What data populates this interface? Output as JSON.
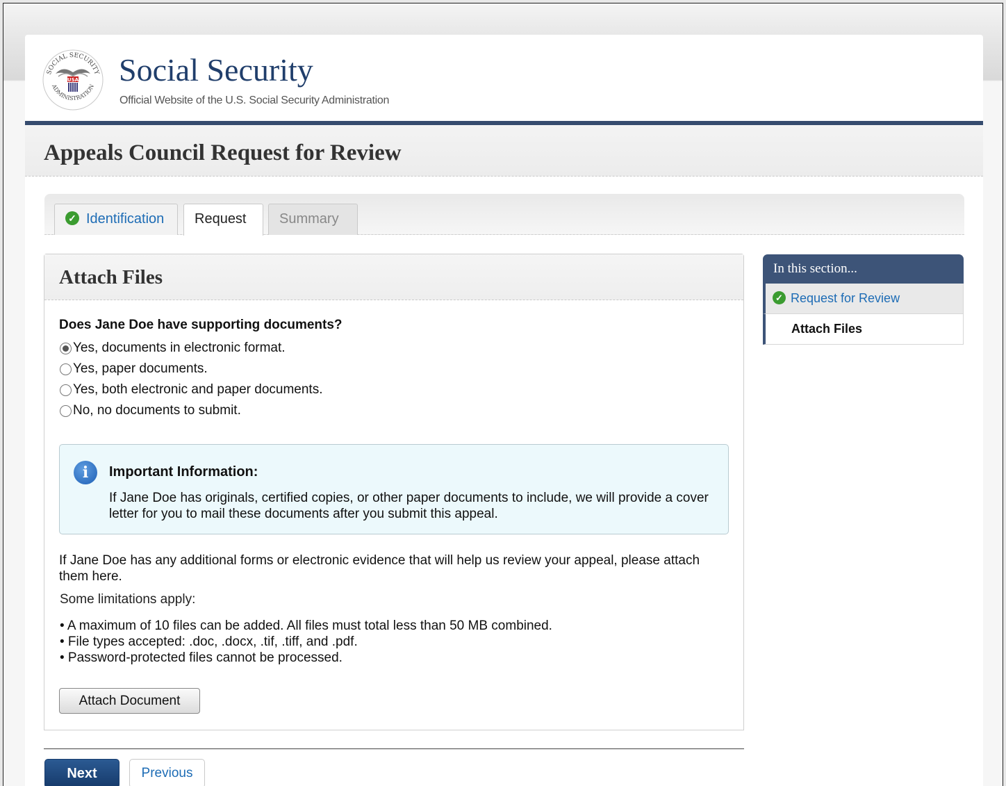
{
  "site": {
    "title": "Social Security",
    "subtitle": "Official Website of the U.S. Social Security Administration",
    "seal_top_text": "SOCIAL SECURITY",
    "seal_bottom_text": "ADMINISTRATION",
    "seal_center_text": "USA"
  },
  "page_title": "Appeals Council Request for Review",
  "tabs": [
    {
      "label": "Identification",
      "state": "completed"
    },
    {
      "label": "Request",
      "state": "active"
    },
    {
      "label": "Summary",
      "state": "disabled"
    }
  ],
  "panel": {
    "title": "Attach Files",
    "question": "Does Jane Doe have supporting documents?",
    "options": [
      {
        "label": "Yes, documents in electronic format.",
        "checked": true
      },
      {
        "label": "Yes, paper documents.",
        "checked": false
      },
      {
        "label": "Yes, both electronic and paper documents.",
        "checked": false
      },
      {
        "label": "No, no documents to submit.",
        "checked": false
      }
    ],
    "info": {
      "title": "Important Information:",
      "text": "If Jane Doe has originals, certified copies, or other paper documents to include, we will provide a cover letter for you to mail these documents after you submit this appeal."
    },
    "body_text": "If Jane Doe has any additional forms or electronic evidence that will help us review your appeal, please attach them here.",
    "limits_intro": "Some limitations apply:",
    "limits": [
      "• A maximum of 10 files can be added. All files must total less than 50 MB combined.",
      "• File types accepted: .doc, .docx, .tif, .tiff, and .pdf.",
      "• Password-protected files cannot be processed."
    ],
    "attach_label": "Attach Document"
  },
  "nav": {
    "next_label": "Next",
    "previous_label": "Previous"
  },
  "sidebar": {
    "heading": "In this section...",
    "items": [
      {
        "label": "Request for Review",
        "state": "completed"
      },
      {
        "label": "Attach Files",
        "state": "current"
      }
    ]
  },
  "colors": {
    "brand_navy": "#203e6b",
    "header_rule": "#354b6e",
    "link_blue": "#1d6cb5",
    "check_green": "#3b9c30",
    "info_bg": "#ecf9fc"
  }
}
